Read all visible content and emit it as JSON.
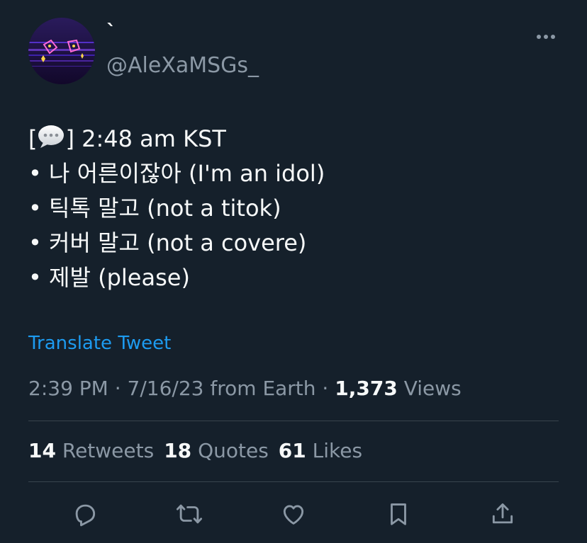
{
  "author": {
    "display_name": "`",
    "handle": "@AleXaMSGs_"
  },
  "tweet": {
    "lines": [
      {
        "prefix": "[",
        "icon": "speech-bubble-emoji",
        "text": "] 2:48 am KST"
      },
      {
        "text": "• 나 어른이잖아 (I'm an idol)"
      },
      {
        "text": "• 틱톡 말고 (not a titok)"
      },
      {
        "text": "• 커버 말고 (not a covere)"
      },
      {
        "text": "• 제발 (please)"
      }
    ]
  },
  "translate_label": "Translate Tweet",
  "meta": {
    "time": "2:39 PM",
    "sep1": " · ",
    "date": "7/16/23",
    "source": " from Earth",
    "sep2": " · ",
    "views_count": "1,373",
    "views_label": " Views"
  },
  "stats": [
    {
      "count": "14",
      "label": " Retweets"
    },
    {
      "count": "18",
      "label": " Quotes"
    },
    {
      "count": "61",
      "label": " Likes"
    }
  ],
  "actions": [
    "reply-icon",
    "retweet-icon",
    "like-icon",
    "bookmark-icon",
    "share-icon"
  ],
  "colors": {
    "background": "#15202b",
    "text": "#f7f9f9",
    "secondary": "#8b98a5",
    "link": "#1d9bf0",
    "divider": "#38444d"
  }
}
